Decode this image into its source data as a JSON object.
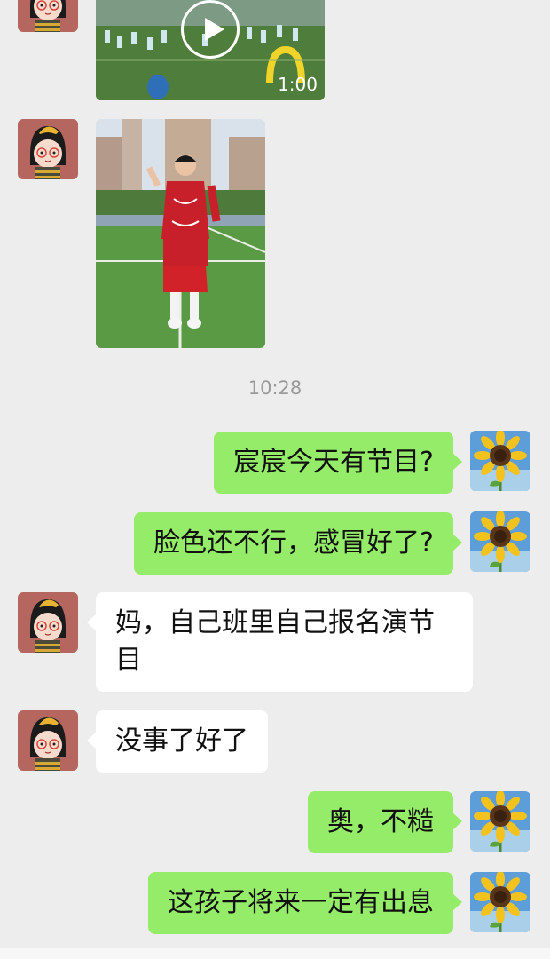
{
  "chat": {
    "video": {
      "duration": "1:00"
    },
    "timestamp": "10:28",
    "messages": [
      {
        "side": "out",
        "text": "宸宸今天有节目?"
      },
      {
        "side": "out",
        "text": "脸色还不行，感冒好了?"
      },
      {
        "side": "in",
        "text": "妈，自己班里自己报名演节目"
      },
      {
        "side": "in",
        "text": "没事了好了"
      },
      {
        "side": "out",
        "text": "奥，不糙"
      },
      {
        "side": "out",
        "text": "这孩子将来一定有出息"
      }
    ]
  }
}
